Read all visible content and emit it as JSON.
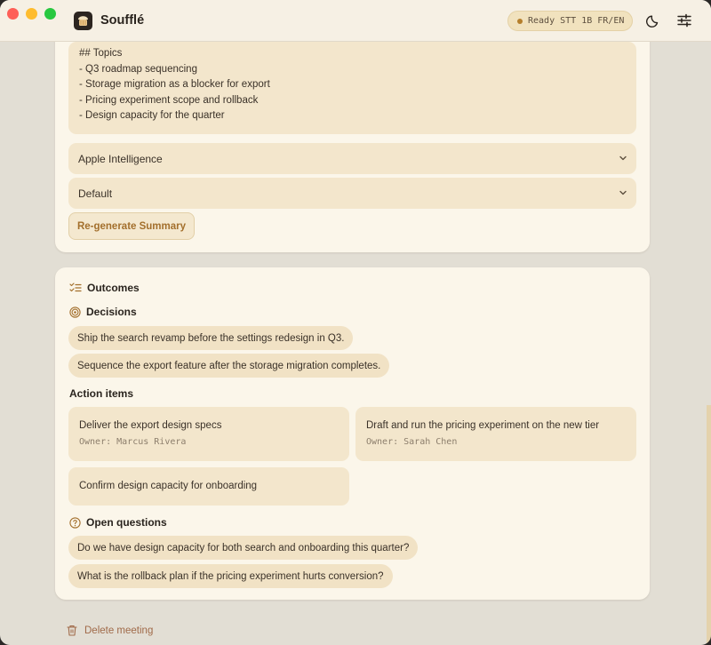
{
  "window": {
    "app_title": "Soufflé",
    "status": {
      "label": "Ready",
      "detail": "STT 1B FR/EN",
      "dot_color": "#b57f2c"
    },
    "icons": {
      "theme": "moon-icon",
      "settings": "sliders-icon"
    }
  },
  "summary": {
    "lines": [
      "## Topics",
      "- Q3 roadmap sequencing",
      "- Storage migration as a blocker for export",
      "- Pricing experiment scope and rollback",
      "- Design capacity for the quarter"
    ],
    "model_select": "Apple Intelligence",
    "style_select": "Default",
    "regenerate_label": "Re-generate Summary"
  },
  "outcomes": {
    "title": "Outcomes",
    "decisions_title": "Decisions",
    "decisions": [
      "Ship the search revamp before the settings redesign in Q3.",
      "Sequence the export feature after the storage migration completes."
    ],
    "actions_title": "Action items",
    "actions": [
      {
        "title": "Deliver the export design specs",
        "owner": "Owner: Marcus Rivera"
      },
      {
        "title": "Draft and run the pricing experiment on the new tier",
        "owner": "Owner: Sarah Chen"
      },
      {
        "title": "Confirm design capacity for onboarding",
        "owner": ""
      }
    ],
    "questions_title": "Open questions",
    "questions": [
      "Do we have design capacity for both search and onboarding this quarter?",
      "What is the rollback plan if the pricing experiment hurts conversion?"
    ]
  },
  "footer": {
    "delete_label": "Delete meeting"
  },
  "colors": {
    "accent": "#a36f2c",
    "card": "#fbf6ea",
    "chip": "#f1e2c5",
    "danger": "#a06a49"
  }
}
